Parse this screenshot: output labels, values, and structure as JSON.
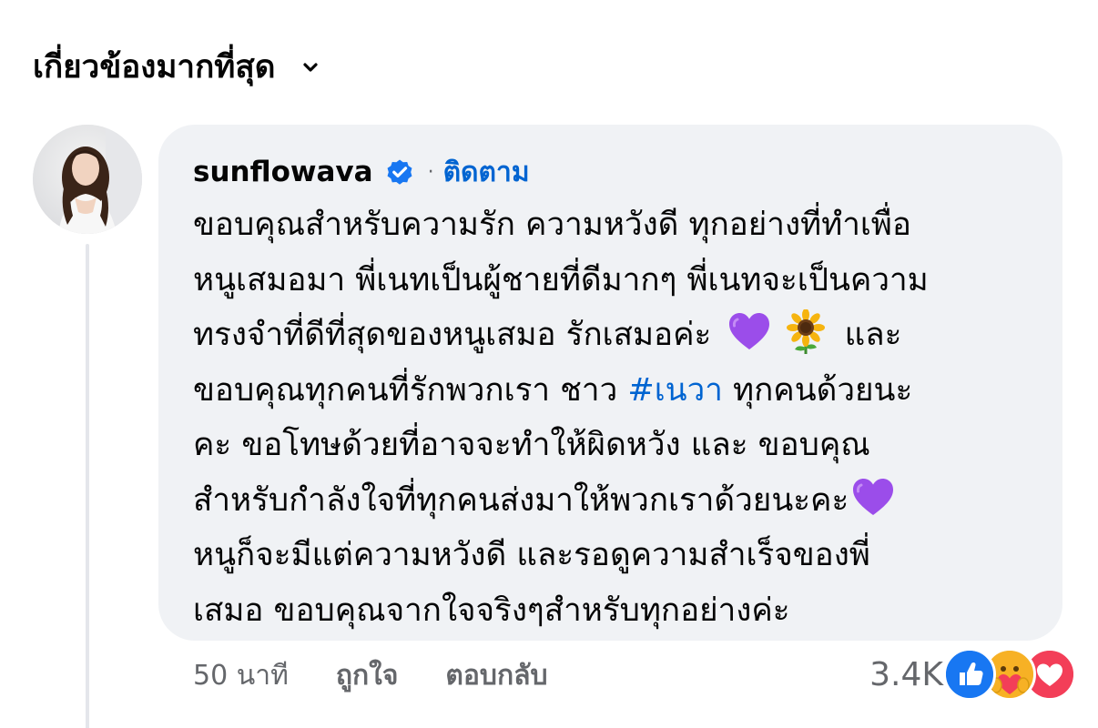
{
  "sort": {
    "label": "เกี่ยวข้องมากที่สุด",
    "icon": "chevron-down-icon"
  },
  "comment": {
    "author": "sunflowava",
    "verified": true,
    "separator": "·",
    "follow_label": "ติดตาม",
    "lines": [
      "ขอบคุณสำหรับความรัก ความหวังดี ทุกอย่างที่ทำเพื่อ",
      "หนูเสมอมา พี่เนทเป็นผู้ชายที่ดีมากๆ พี่เนทจะเป็นความ",
      "ทรงจำที่ดีที่สุดของหนูเสมอ รักเสมอค่ะ",
      "และ",
      "ขอบคุณทุกคนที่รักพวกเรา ชาว",
      "#เนวา",
      "ทุกคนด้วยนะ",
      "คะ ขอโทษด้วยที่อาจจะทำให้ผิดหวัง และ ขอบคุณ",
      "สำหรับกำลังใจที่ทุกคนส่งมาให้พวกเราด้วยนะคะ",
      "หนูก็จะมีแต่ความหวังดี และรอดูความสำเร็จของพี่",
      "เสมอ ขอบคุณจากใจจริงๆสำหรับทุกอย่างค่ะ"
    ],
    "time": "50 นาที",
    "like_label": "ถูกใจ",
    "reply_label": "ตอบกลับ",
    "reaction_count": "3.4K",
    "reactions": [
      "like-reaction-icon",
      "care-reaction-icon",
      "love-reaction-icon"
    ]
  },
  "colors": {
    "bubble": "#f0f2f5",
    "link": "#0064d1",
    "secondary_text": "#65676b",
    "like_blue": "#1877f2",
    "love_red": "#f33e58",
    "care_yellow": "#f7b125",
    "purple_heart": "#9b4dea"
  }
}
